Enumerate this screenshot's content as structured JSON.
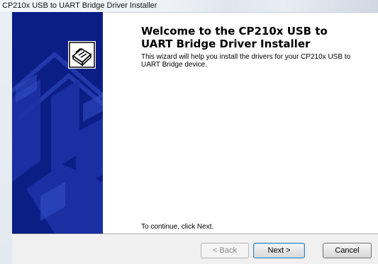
{
  "window": {
    "title": "CP210x USB to UART Bridge Driver Installer"
  },
  "sidebar": {
    "logo_icon": "usb-device-icon",
    "background_color": "#0b1e86"
  },
  "content": {
    "heading": "Welcome to the CP210x USB to UART Bridge Driver Installer",
    "description": "This wizard will help you install the drivers for your CP210x USB to UART Bridge device.",
    "continue_hint": "To continue, click Next."
  },
  "buttons": {
    "back": "< Back",
    "next": "Next >",
    "cancel": "Cancel"
  }
}
